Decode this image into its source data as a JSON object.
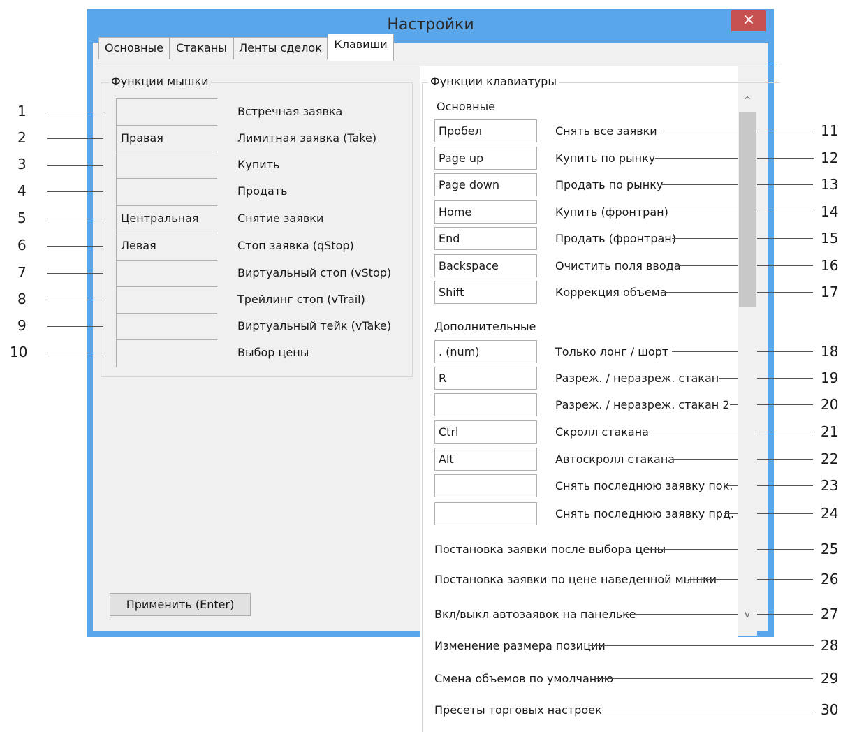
{
  "window": {
    "title": "Настройки",
    "close_icon": "×"
  },
  "tabs": [
    {
      "label": "Основные"
    },
    {
      "label": "Стаканы"
    },
    {
      "label": "Ленты сделок"
    },
    {
      "label": "Клавиши",
      "active": true
    }
  ],
  "mouse": {
    "legend": "Функции мышки",
    "rows": [
      {
        "value": "",
        "label": "Встречная заявка",
        "num": "1"
      },
      {
        "value": "Правая",
        "label": "Лимитная заявка (Take)",
        "num": "2"
      },
      {
        "value": "",
        "label": "Купить",
        "num": "3"
      },
      {
        "value": "",
        "label": "Продать",
        "num": "4"
      },
      {
        "value": "Центральная",
        "label": "Снятие заявки",
        "num": "5"
      },
      {
        "value": "Левая",
        "label": "Стоп заявка (qStop)",
        "num": "6"
      },
      {
        "value": "",
        "label": "Виртуальный стоп (vStop)",
        "num": "7"
      },
      {
        "value": "",
        "label": "Трейлинг стоп (vTrail)",
        "num": "8"
      },
      {
        "value": "",
        "label": "Виртуальный тейк (vTake)",
        "num": "9"
      },
      {
        "value": "",
        "label": "Выбор цены",
        "num": "10"
      }
    ],
    "apply_label": "Применить (Enter)"
  },
  "keyboard": {
    "legend": "Функции клавиатуры",
    "basic_header": "Основные",
    "basic": [
      {
        "key": "Пробел",
        "label": "Снять все заявки",
        "num": "11"
      },
      {
        "key": "Page up",
        "label": "Купить по рынку",
        "num": "12"
      },
      {
        "key": "Page down",
        "label": "Продать по рынку",
        "num": "13"
      },
      {
        "key": "Home",
        "label": "Купить (фронтран)",
        "num": "14"
      },
      {
        "key": "End",
        "label": "Продать (фронтран)",
        "num": "15"
      },
      {
        "key": "Backspace",
        "label": "Очистить поля ввода",
        "num": "16"
      },
      {
        "key": "Shift",
        "label": "Коррекция объема",
        "num": "17"
      }
    ],
    "extra_header": "Дополнительные",
    "extra": [
      {
        "key": ". (num)",
        "label": "Только лонг / шорт",
        "num": "18"
      },
      {
        "key": "R",
        "label": "Разреж. / неразреж. стакан",
        "num": "19"
      },
      {
        "key": "",
        "label": "Разреж. / неразреж. стакан 2",
        "num": "20"
      },
      {
        "key": "Ctrl",
        "label": "Скролл стакана",
        "num": "21"
      },
      {
        "key": "Alt",
        "label": "Автоскролл стакана",
        "num": "22"
      },
      {
        "key": "",
        "label": "Снять последнюю заявку пок.",
        "num": "23"
      },
      {
        "key": "",
        "label": "Снять последнюю заявку прд.",
        "num": "24"
      }
    ],
    "options": [
      {
        "label": "Постановка заявки после выбора цены",
        "num": "25"
      },
      {
        "label": "Постановка заявки по цене наведенной мышки",
        "num": "26"
      },
      {
        "label": "Вкл/выкл автозаявок на панельке",
        "num": "27"
      },
      {
        "label": "Изменение размера позиции",
        "num": "28"
      },
      {
        "label": "Смена объемов по умолчанию",
        "num": "29"
      },
      {
        "label": "Пресеты торговых настроек",
        "num": "30"
      }
    ]
  },
  "scrollbar": {
    "up_icon": "^",
    "down_icon": "v"
  }
}
